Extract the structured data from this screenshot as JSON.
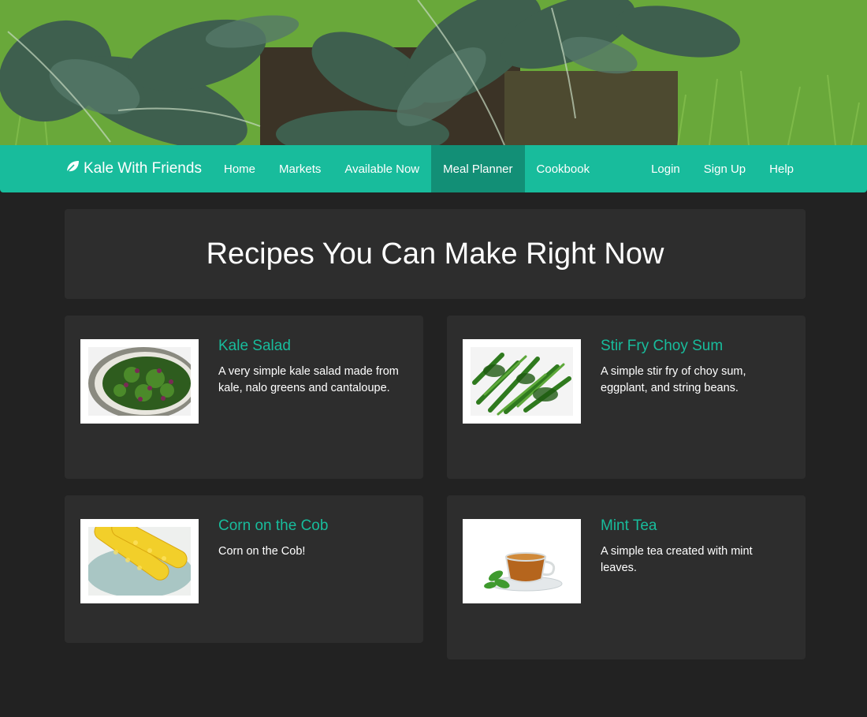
{
  "brand": {
    "name": "Kale With Friends",
    "icon": "leaf-icon"
  },
  "nav": {
    "left": [
      {
        "label": "Home",
        "active": false
      },
      {
        "label": "Markets",
        "active": false
      },
      {
        "label": "Available Now",
        "active": false
      },
      {
        "label": "Meal Planner",
        "active": true
      },
      {
        "label": "Cookbook",
        "active": false
      }
    ],
    "right": [
      {
        "label": "Login"
      },
      {
        "label": "Sign Up"
      },
      {
        "label": "Help"
      }
    ]
  },
  "page": {
    "title": "Recipes You Can Make Right Now"
  },
  "recipes": [
    {
      "title": "Kale Salad",
      "description": "A very simple kale salad made from kale, nalo greens and cantaloupe."
    },
    {
      "title": "Stir Fry Choy Sum",
      "description": "A simple stir fry of choy sum, eggplant, and string beans."
    },
    {
      "title": "Corn on the Cob",
      "description": "Corn on the Cob!"
    },
    {
      "title": "Mint Tea",
      "description": "A simple tea created with mint leaves."
    }
  ],
  "colors": {
    "accent": "#18bc9c",
    "accent_active": "#128f76",
    "background": "#222222",
    "panel": "#2d2d2d"
  }
}
